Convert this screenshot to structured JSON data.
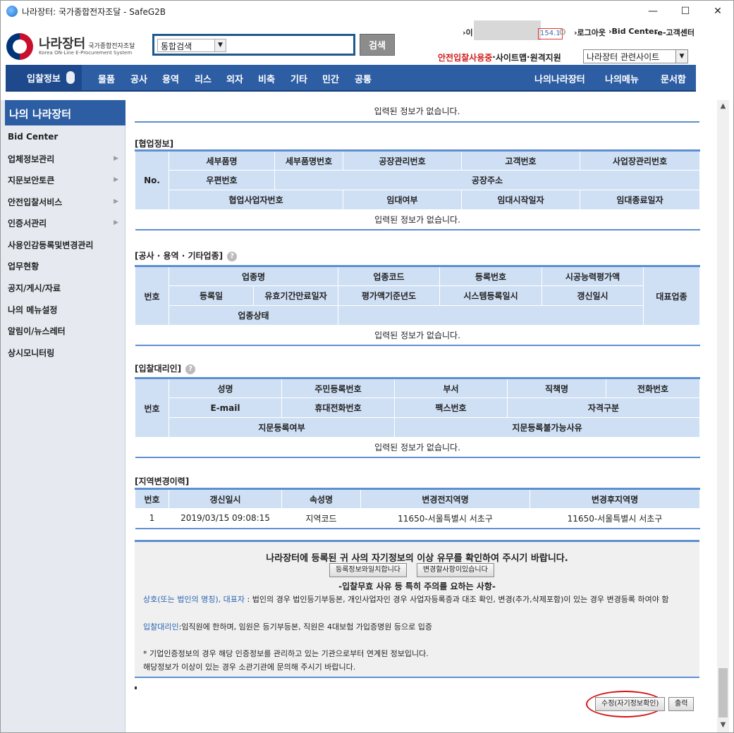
{
  "window": {
    "title": "나라장터: 국가종합전자조달 - SafeG2B",
    "min": "—",
    "max": "☐",
    "close": "✕"
  },
  "logo": {
    "main": "나라장터",
    "sub": "국가종합전자조달",
    "eng": "Korea ON-Line E-Procurement System"
  },
  "search": {
    "scope": "통합검색",
    "button": "검색"
  },
  "toplinks": {
    "prefix": "›이",
    "ip": "154.1",
    "logout": "›로그아웃",
    "bidcenter": "›Bid Center",
    "customer": "›e-고객센터"
  },
  "sublinks": {
    "safe": "안전입찰사용중",
    "sep1": " · ",
    "sitemap": "사이트맵",
    "sep2": " · ",
    "remote": "원격지원",
    "related": "나라장터 관련사이트"
  },
  "nav": {
    "bid": "입찰정보",
    "items": [
      "물품",
      "공사",
      "용역",
      "리스",
      "외자",
      "비축",
      "기타",
      "민간",
      "공통"
    ],
    "right": [
      "나의나라장터",
      "나의메뉴",
      "문서함"
    ]
  },
  "sidebar": {
    "title": "나의 나라장터",
    "items": [
      "Bid Center",
      "업체정보관리",
      "지문보안토큰",
      "안전입찰서비스",
      "인증서관리",
      "사용인감등록및변경관리",
      "업무현황",
      "공지/게시/자료",
      "나의 메뉴설정",
      "알림이/뉴스레터",
      "상시모니터링"
    ]
  },
  "empty": "입력된 정보가 없습니다.",
  "coop": {
    "title": "[협업정보]",
    "no": "No.",
    "h1": [
      "세부품명",
      "세부품명번호",
      "공장관리번호",
      "고객번호",
      "사업장관리번호"
    ],
    "h2": [
      "우편번호",
      "공장주소"
    ],
    "h3": [
      "협업사업자번호",
      "임대여부",
      "임대시작일자",
      "임대종료일자"
    ]
  },
  "industry": {
    "title": "[공사 · 용역 · 기타업종]",
    "num": "번호",
    "rep": "대표업종",
    "h1": [
      "업종명",
      "업종코드",
      "등록번호",
      "시공능력평가액"
    ],
    "h2": [
      "등록일",
      "유효기간만료일자",
      "평가액기준년도",
      "시스템등록일시",
      "갱신일시"
    ],
    "h3": [
      "업종상태"
    ]
  },
  "agent": {
    "title": "[입찰대리인]",
    "num": "번호",
    "h1": [
      "성명",
      "주민등록번호",
      "부서",
      "직책명",
      "전화번호"
    ],
    "h2": [
      "E-mail",
      "휴대전화번호",
      "팩스번호",
      "자격구분"
    ],
    "h3": [
      "지문등록여부",
      "지문등록불가능사유"
    ]
  },
  "region": {
    "title": "[지역변경이력]",
    "headers": [
      "번호",
      "갱신일시",
      "속성명",
      "변경전지역명",
      "변경후지역명"
    ],
    "rows": [
      [
        "1",
        "2019/03/15 09:08:15",
        "지역코드",
        "11650-서울특별시 서초구",
        "11650-서울특별시 서초구"
      ]
    ]
  },
  "notice": {
    "heading": "나라장터에 등록된 귀 사의 자기정보의 이상 유무를 확인하여 주시기 바랍니다.",
    "btn_match": "등록정보와일치합니다",
    "btn_change": "변경할사항이있습니다",
    "caution": "-입찰무효 사유 등 특히 주의를 요하는 사항-",
    "l1_blue": "상호(또는 법인의 명칭), 대표자",
    "l1_rest": " : 법인의 경우 법인등기부등본, 개인사업자인 경우 사업자등록증과 대조 확인, 변경(추가,삭제포함)이 있는 경우 변경등록 하여야 함",
    "l2_blue": "입찰대리인",
    "l2_rest": ":임직원에 한하며, 임원은 등기부등본, 직원은 4대보험 가입증명원 등으로 입증",
    "l3": "* 기업인증정보의 경우 해당 인증정보를 관리하고 있는 기관으로부터 연계된 정보입니다.",
    "l4": "해당정보가 이상이 있는 경우 소관기관에 문의해 주시기 바랍니다."
  },
  "actions": {
    "edit": "수정(자기정보확인)",
    "print": "출력"
  }
}
